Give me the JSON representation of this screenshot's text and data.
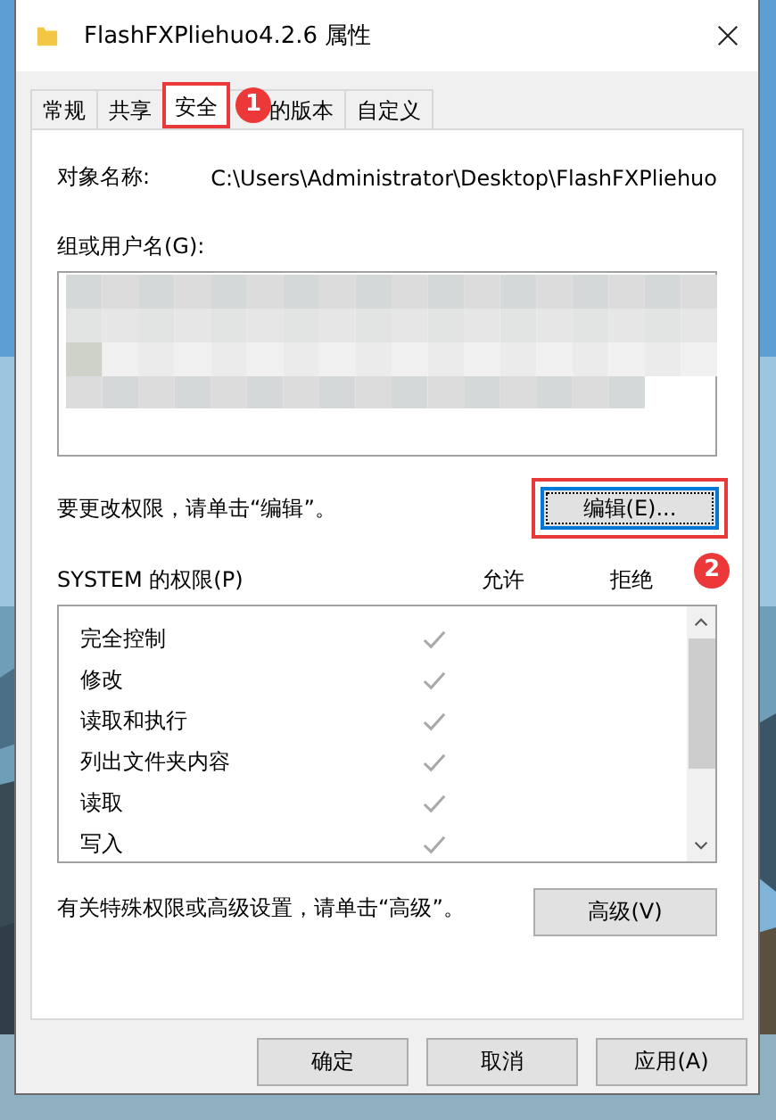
{
  "window": {
    "title": "FlashFXPliehuo4.2.6 属性"
  },
  "tabs": [
    {
      "label": "常规",
      "selected": false,
      "highlighted": false
    },
    {
      "label": "共享",
      "selected": false,
      "highlighted": false
    },
    {
      "label": "安全",
      "selected": true,
      "highlighted": true,
      "badge": "1"
    },
    {
      "label": "的版本",
      "selected": false,
      "highlighted": false
    },
    {
      "label": "自定义",
      "selected": false,
      "highlighted": false
    }
  ],
  "object_name": {
    "label": "对象名称:",
    "value": "C:\\Users\\Administrator\\Desktop\\FlashFXPliehuo"
  },
  "groups": {
    "label": "组或用户名(G):"
  },
  "edit_hint": "要更改权限，请单击“编辑”。",
  "edit_button": {
    "label": "编辑(E)...",
    "highlighted": true,
    "focused": true,
    "badge": "2"
  },
  "permissions": {
    "title": "SYSTEM 的权限(P)",
    "allow_header": "允许",
    "deny_header": "拒绝",
    "rows": [
      {
        "name": "完全控制",
        "allow": true,
        "deny": false
      },
      {
        "name": "修改",
        "allow": true,
        "deny": false
      },
      {
        "name": "读取和执行",
        "allow": true,
        "deny": false
      },
      {
        "name": "列出文件夹内容",
        "allow": true,
        "deny": false
      },
      {
        "name": "读取",
        "allow": true,
        "deny": false
      },
      {
        "name": "写入",
        "allow": true,
        "deny": false
      }
    ]
  },
  "advanced_hint": "有关特殊权限或高级设置，请单击“高级”。",
  "advanced_button": "高级(V)",
  "buttons": [
    "确定",
    "取消",
    "应用(A)"
  ]
}
